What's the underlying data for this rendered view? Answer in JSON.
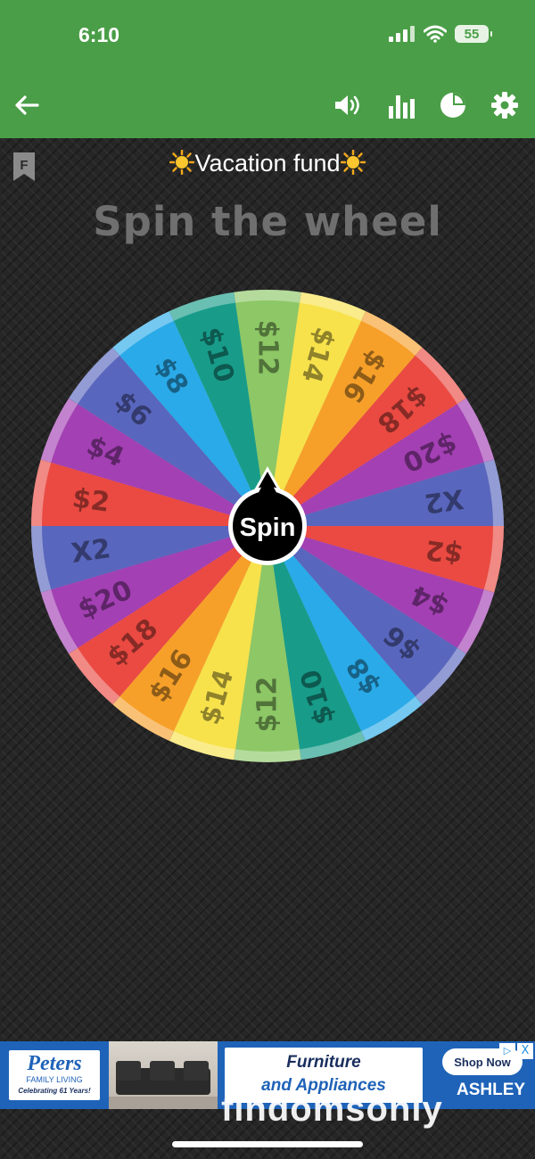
{
  "status_bar": {
    "time": "6:10",
    "battery": "55"
  },
  "toolbar": {
    "back_icon": "arrow-left-icon",
    "sound_icon": "volume-icon",
    "stats_icon": "bar-chart-icon",
    "pie_icon": "pie-chart-icon",
    "settings_icon": "gear-icon"
  },
  "page": {
    "flag_letter": "F",
    "title": "Vacation fund",
    "title_icon": "sun-icon",
    "subtitle": "Spin the wheel"
  },
  "wheel": {
    "center_label": "Spin",
    "segments": [
      {
        "label": "$12",
        "color": "#8dc766"
      },
      {
        "label": "$14",
        "color": "#f7e24b"
      },
      {
        "label": "$16",
        "color": "#f6a02a"
      },
      {
        "label": "$18",
        "color": "#ea4a42"
      },
      {
        "label": "$20",
        "color": "#a340b3"
      },
      {
        "label": "X2",
        "color": "#5966bd"
      },
      {
        "label": "$2",
        "color": "#ea4a42"
      },
      {
        "label": "$4",
        "color": "#a340b3"
      },
      {
        "label": "$6",
        "color": "#5966bd"
      },
      {
        "label": "$8",
        "color": "#2aaae8"
      },
      {
        "label": "$10",
        "color": "#189c89"
      },
      {
        "label": "$12",
        "color": "#8dc766"
      },
      {
        "label": "$14",
        "color": "#f7e24b"
      },
      {
        "label": "$16",
        "color": "#f6a02a"
      },
      {
        "label": "$18",
        "color": "#ea4a42"
      },
      {
        "label": "$20",
        "color": "#a340b3"
      },
      {
        "label": "X2",
        "color": "#5966bd"
      },
      {
        "label": "$2",
        "color": "#ea4a42"
      },
      {
        "label": "$4",
        "color": "#a340b3"
      },
      {
        "label": "$6",
        "color": "#5966bd"
      },
      {
        "label": "$8",
        "color": "#2aaae8"
      },
      {
        "label": "$10",
        "color": "#189c89"
      }
    ]
  },
  "ad": {
    "brand": "Peters",
    "brand_sub": "FAMILY LIVING",
    "brand_tag": "Celebrating 61 Years!",
    "headline_1": "Furniture",
    "headline_2": "and Appliances",
    "cta": "Shop Now",
    "partner": "ASHLEY",
    "close": "X"
  },
  "watermark": "findomsonly",
  "colors": {
    "toolbar": "#4a9e47",
    "background": "#262626"
  }
}
